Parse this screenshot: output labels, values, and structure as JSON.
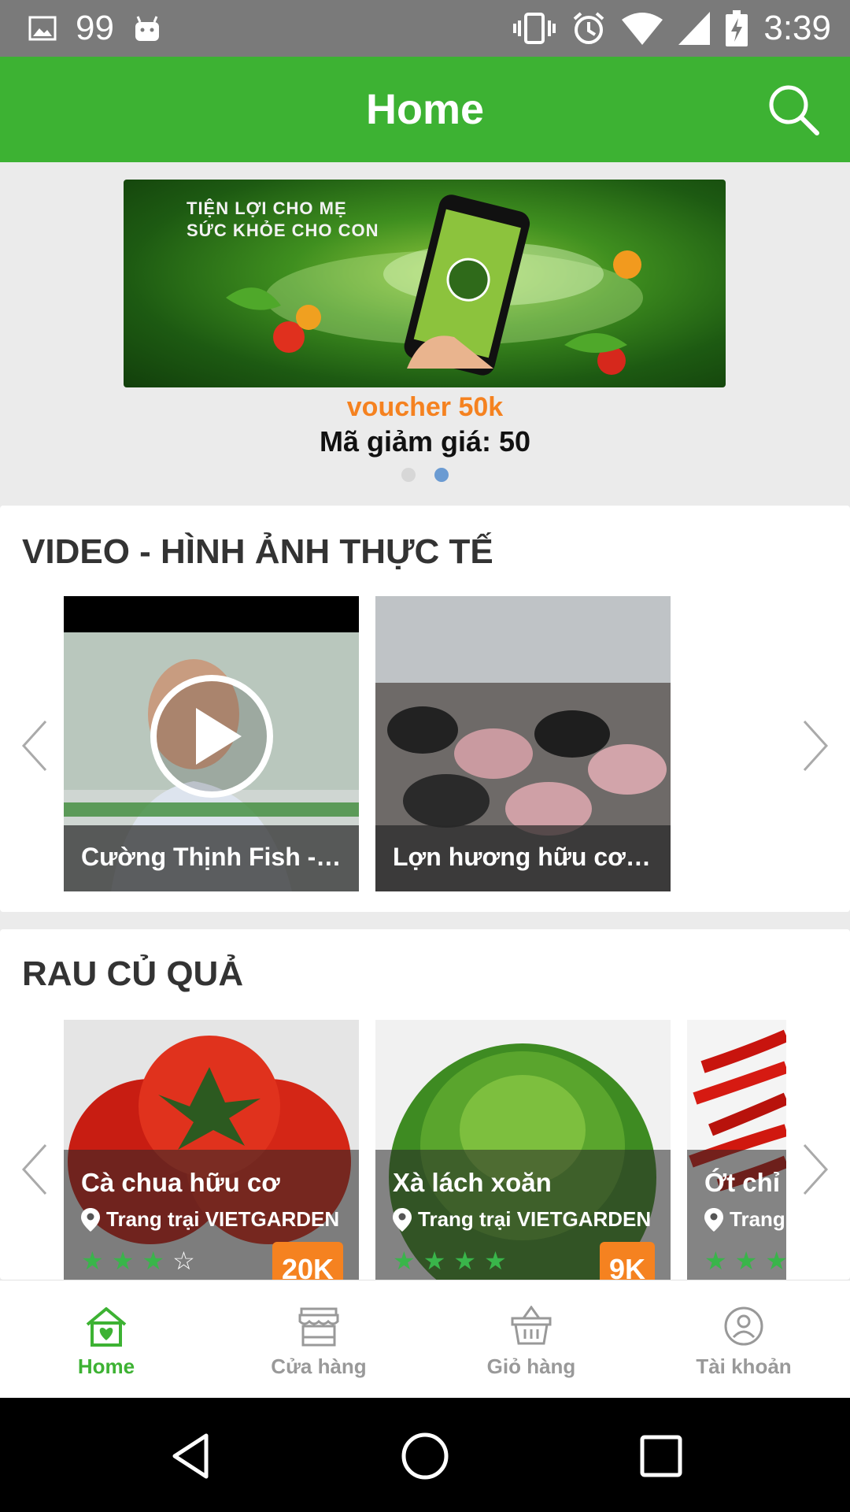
{
  "status_bar": {
    "notification_count": "99",
    "time": "3:39",
    "icons": [
      "image-icon",
      "android-icon",
      "vibrate-icon",
      "alarm-icon",
      "wifi-icon",
      "signal-icon",
      "battery-charging-icon"
    ]
  },
  "app_bar": {
    "title": "Home",
    "search_icon": "search-icon",
    "background": "#3db233"
  },
  "banner": {
    "image_line1": "TIỆN LỢI CHO MẸ",
    "image_line2": "SỨC KHỎE CHO CON",
    "voucher_title": "voucher 50k",
    "voucher_code": "Mã giảm giá: 50",
    "page_count": 2,
    "active_page": 1
  },
  "video_section": {
    "title": "VIDEO - HÌNH ẢNH THỰC TẾ",
    "items": [
      {
        "caption": "Cường Thịnh Fish - ..."
      },
      {
        "caption": "Lợn hương hữu cơ c..."
      }
    ]
  },
  "veg_section": {
    "title": "RAU CỦ QUẢ",
    "items": [
      {
        "name": "Cà chua hữu cơ",
        "farm": "Trang trại VIETGARDEN",
        "rating": 3,
        "price": "20K"
      },
      {
        "name": "Xà lách xoăn",
        "farm": "Trang trại VIETGARDEN",
        "rating": 4,
        "price": "9K"
      },
      {
        "name": "Ớt chỉ t",
        "farm": "Trang",
        "rating": 3,
        "price": ""
      }
    ]
  },
  "bottom_nav": {
    "items": [
      {
        "label": "Home",
        "icon": "home-heart-icon",
        "active": true
      },
      {
        "label": "Cửa hàng",
        "icon": "store-icon",
        "active": false
      },
      {
        "label": "Giỏ hàng",
        "icon": "basket-icon",
        "active": false
      },
      {
        "label": "Tài khoản",
        "icon": "account-icon",
        "active": false
      }
    ]
  },
  "colors": {
    "primary": "#3db233",
    "voucher": "#f58220",
    "price_badge": "#f58220",
    "star": "#39b54a",
    "dot_active": "#6b9bd2"
  }
}
